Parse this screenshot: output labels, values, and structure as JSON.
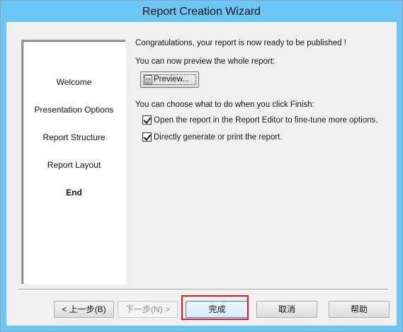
{
  "window": {
    "title": "Report Creation Wizard"
  },
  "steps": [
    {
      "label": "Welcome",
      "active": false
    },
    {
      "label": "Presentation Options",
      "active": false
    },
    {
      "label": "Report Structure",
      "active": false
    },
    {
      "label": "Report Layout",
      "active": false
    },
    {
      "label": "End",
      "active": true
    }
  ],
  "content": {
    "congrats": "Congratulations, your report is now ready to be published !",
    "preview_hint": "You can now preview the whole report:",
    "preview_button": "Preview...",
    "finish_hint": "You can choose what to do when you click Finish:",
    "options": [
      {
        "label": "Open the report in the Report Editor to fine-tune more options.",
        "checked": true
      },
      {
        "label": "Directly generate or print the report.",
        "checked": true
      }
    ]
  },
  "buttons": {
    "back": "< 上一步(B)",
    "next": "下一步(N) >",
    "finish": "完成",
    "cancel": "取消",
    "help": "帮助"
  },
  "highlight_color": "#e8141b"
}
